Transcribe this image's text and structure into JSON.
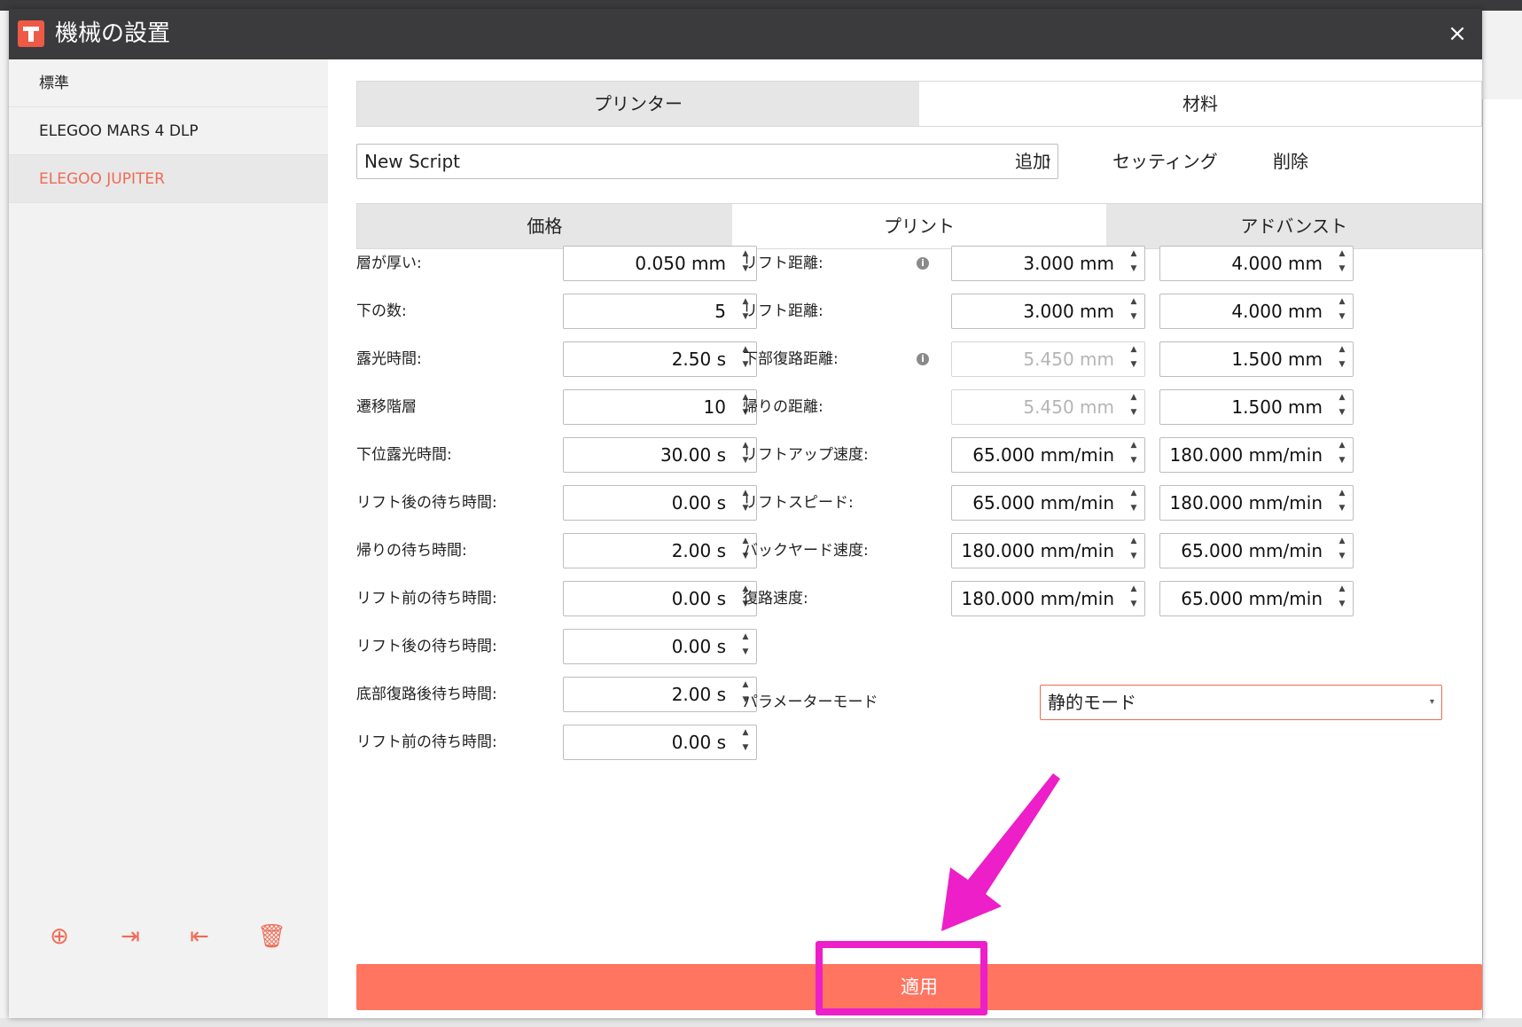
{
  "dialog": {
    "title": "機械の設置",
    "close_label": "×"
  },
  "sidebar": {
    "items": [
      {
        "label": "標準"
      },
      {
        "label": "ELEGOO MARS 4 DLP"
      },
      {
        "label": "ELEGOO JUPITER",
        "selected": true
      }
    ],
    "actions": [
      {
        "icon": "add-circle-icon",
        "glyph": "⊕"
      },
      {
        "icon": "import-icon",
        "glyph": "⇥"
      },
      {
        "icon": "export-icon",
        "glyph": "⇤"
      },
      {
        "icon": "trash-icon",
        "glyph": "🗑"
      }
    ]
  },
  "main_tabs": [
    {
      "label": "プリンター",
      "active": false
    },
    {
      "label": "材料",
      "active": true
    }
  ],
  "script": {
    "selected": "New Script",
    "buttons": {
      "add": "追加",
      "settings": "セッティング",
      "delete": "削除"
    }
  },
  "sub_tabs": [
    {
      "label": "価格",
      "active": false
    },
    {
      "label": "プリント",
      "active": true
    },
    {
      "label": "アドバンスト",
      "active": false
    }
  ],
  "left_params": [
    {
      "label": "層が厚い:",
      "value": "0.050 mm"
    },
    {
      "label": "下の数:",
      "value": "5"
    },
    {
      "label": "露光時間:",
      "value": "2.50 s"
    },
    {
      "label": "遷移階層",
      "value": "10"
    },
    {
      "label": "下位露光時間:",
      "value": "30.00 s"
    },
    {
      "label": "リフト後の待ち時間:",
      "value": "0.00 s"
    },
    {
      "label": "帰りの待ち時間:",
      "value": "2.00 s"
    },
    {
      "label": "リフト前の待ち時間:",
      "value": "0.00 s"
    },
    {
      "label": "リフト後の待ち時間:",
      "value": "0.00 s"
    },
    {
      "label": "底部復路後待ち時間:",
      "value": "2.00 s"
    },
    {
      "label": "リフト前の待ち時間:",
      "value": "0.00 s"
    }
  ],
  "right_params": [
    {
      "label": "リフト距離:",
      "info": true,
      "value1": "3.000 mm",
      "value2": "4.000 mm",
      "disabled1": false
    },
    {
      "label": "リフト距離:",
      "info": false,
      "value1": "3.000 mm",
      "value2": "4.000 mm",
      "disabled1": false
    },
    {
      "label": "下部復路距離:",
      "info": true,
      "value1": "5.450 mm",
      "value2": "1.500 mm",
      "disabled1": true
    },
    {
      "label": "帰りの距離:",
      "info": false,
      "value1": "5.450 mm",
      "value2": "1.500 mm",
      "disabled1": true
    },
    {
      "label": "リフトアップ速度:",
      "info": false,
      "value1": "65.000 mm/min",
      "value2": "180.000 mm/min",
      "disabled1": false
    },
    {
      "label": "リフトスピード:",
      "info": false,
      "value1": "65.000 mm/min",
      "value2": "180.000 mm/min",
      "disabled1": false
    },
    {
      "label": "バックヤード速度:",
      "info": false,
      "value1": "180.000 mm/min",
      "value2": "65.000 mm/min",
      "disabled1": false
    },
    {
      "label": "復路速度:",
      "info": false,
      "value1": "180.000 mm/min",
      "value2": "65.000 mm/min",
      "disabled1": false
    }
  ],
  "param_mode": {
    "label": "パラメーターモード",
    "value": "静的モード"
  },
  "apply_label": "適用",
  "colors": {
    "accent": "#ff7560",
    "highlight": "#ec1fc8",
    "titlebar": "#3b3b3e"
  }
}
